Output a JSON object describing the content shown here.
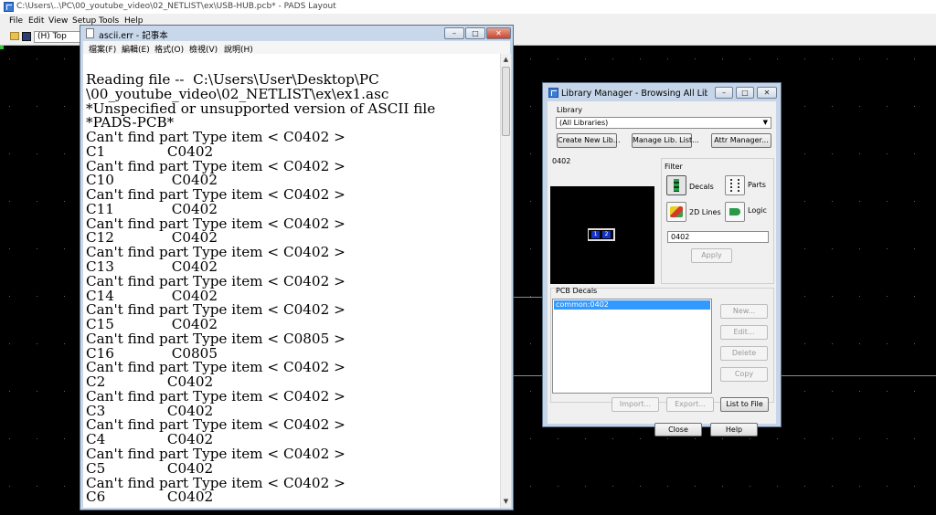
{
  "pads": {
    "title": "C:\\Users\\..\\PC\\00_youtube_video\\02_NETLIST\\ex\\USB-HUB.pcb* - PADS Layout",
    "menu": [
      "File",
      "Edit",
      "View",
      "Setup",
      "Tools",
      "Help"
    ],
    "layer": "(H) Top"
  },
  "notepad": {
    "title": "ascii.err - 記事本",
    "menu": [
      "檔案(F)",
      "編輯(E)",
      "格式(O)",
      "檢視(V)",
      "說明(H)"
    ],
    "lines": [
      "Reading file --  C:\\Users\\User\\Desktop\\PC",
      "\\00_youtube_video\\02_NETLIST\\ex\\ex1.asc",
      "*Unspecified or unsupported version of ASCII file",
      "*PADS-PCB*",
      "Can't find part Type item < C0402 >",
      "C1              C0402",
      "Can't find part Type item < C0402 >",
      "C10             C0402",
      "Can't find part Type item < C0402 >",
      "C11             C0402",
      "Can't find part Type item < C0402 >",
      "C12             C0402",
      "Can't find part Type item < C0402 >",
      "C13             C0402",
      "Can't find part Type item < C0402 >",
      "C14             C0402",
      "Can't find part Type item < C0402 >",
      "C15             C0402",
      "Can't find part Type item < C0805 >",
      "C16             C0805",
      "Can't find part Type item < C0402 >",
      "C2              C0402",
      "Can't find part Type item < C0402 >",
      "C3              C0402",
      "Can't find part Type item < C0402 >",
      "C4              C0402",
      "Can't find part Type item < C0402 >",
      "C5              C0402",
      "Can't find part Type item < C0402 >",
      "C6              C0402"
    ]
  },
  "library_manager": {
    "title": "Library Manager - Browsing All Librari...",
    "library_label": "Library",
    "library_value": "(All Libraries)",
    "create_new_lib": "Create New Lib...",
    "manage_lib_list": "Manage Lib. List...",
    "attr_manager": "Attr Manager...",
    "preview_label": "0402",
    "filter_label": "Filter",
    "decals": "Decals",
    "parts": "Parts",
    "lines_2d": "2D Lines",
    "logic": "Logic",
    "filter_value": "0402",
    "apply": "Apply",
    "pcb_decals_label": "PCB Decals",
    "decal_items": [
      "common:0402"
    ],
    "new": "New...",
    "edit": "Edit...",
    "delete": "Delete",
    "copy": "Copy",
    "import": "Import...",
    "export": "Export...",
    "list_to_file": "List to File",
    "close": "Close",
    "help": "Help",
    "pad_labels": [
      "1",
      "2"
    ]
  },
  "colors": {
    "selection": "#3399ff",
    "canvas": "#000000"
  }
}
